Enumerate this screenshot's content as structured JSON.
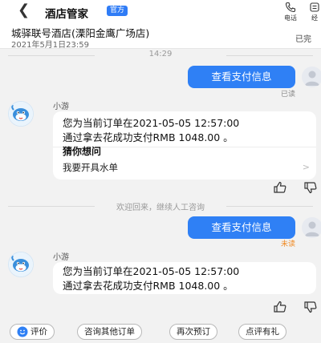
{
  "header": {
    "back_icon": "chevron-left-icon",
    "title": "酒店管家",
    "official_badge": "官方",
    "phone_label": "电话",
    "more_label": "经"
  },
  "hotel": {
    "name": "城驿联号酒店(溧阳金鹰广场店)",
    "date": "2021年5月1日23:59",
    "status": "已完"
  },
  "messages": {
    "time_1": "14:29",
    "user_msg_1": "查看支付信息",
    "user_msg_1_status": "已读",
    "bot_name_1": "小游",
    "bot_msg_1_line1": "您为当前订单在2021-05-05 12:57:00",
    "bot_msg_1_line2": "通过拿去花成功支付RMB 1048.00 。",
    "guess_title": "猜你想问",
    "guess_item_1": "我要开具水单",
    "system_notice": "欢迎回来，继续人工咨询",
    "user_msg_2": "查看支付信息",
    "user_msg_2_status": "未读",
    "bot_name_2": "小游",
    "bot_msg_2_line1": "您为当前订单在2021-05-05 12:57:00",
    "bot_msg_2_line2": "通过拿去花成功支付RMB 1048.00 。"
  },
  "quick_replies": {
    "rate": "评价",
    "other_orders": "咨询其他订单",
    "rebook": "再次预订",
    "review_gift": "点评有礼"
  },
  "colors": {
    "accent": "#2f80f5",
    "read_status": "#888888",
    "unread_status": "#f08a24"
  }
}
